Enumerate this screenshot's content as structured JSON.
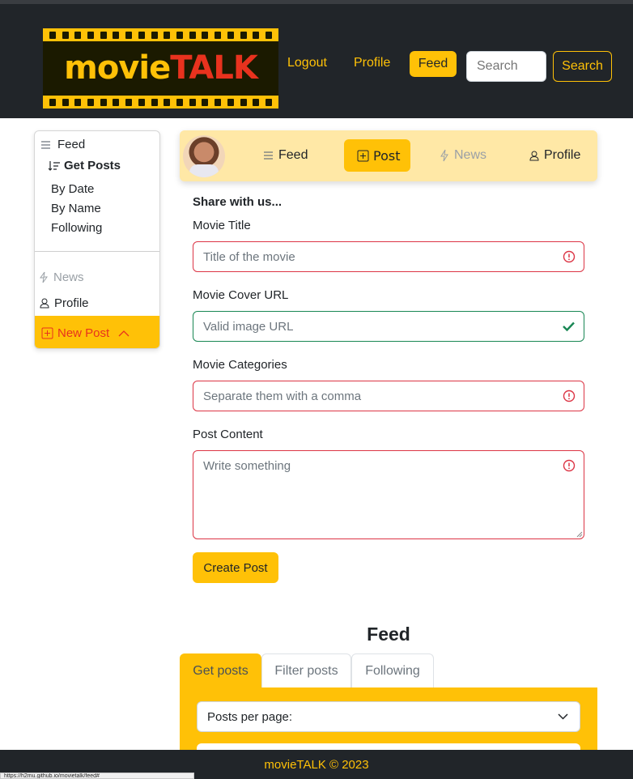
{
  "navbar": {
    "logo": {
      "part1": "movie",
      "part2": "TALK"
    },
    "links": {
      "logout": "Logout",
      "profile": "Profile",
      "feed": "Feed"
    },
    "search": {
      "placeholder": "Search",
      "button": "Search"
    }
  },
  "sidebar": {
    "feed": "Feed",
    "get_posts": "Get Posts",
    "by_date": "By Date",
    "by_name": "By Name",
    "following": "Following",
    "news": "News",
    "profile": "Profile",
    "new_post": "New Post"
  },
  "postnav": {
    "feed": "Feed",
    "post": "Post",
    "news": "News",
    "profile": "Profile"
  },
  "form": {
    "heading": "Share with us...",
    "title_label": "Movie Title",
    "title_placeholder": "Title of the movie",
    "cover_label": "Movie Cover URL",
    "cover_placeholder": "Valid image URL",
    "categories_label": "Movie Categories",
    "categories_placeholder": "Separate them with a comma",
    "content_label": "Post Content",
    "content_placeholder": "Write something",
    "submit": "Create Post"
  },
  "feed": {
    "title": "Feed",
    "tabs": [
      "Get posts",
      "Filter posts",
      "Following"
    ],
    "posts_per_page": "Posts per page:"
  },
  "footer": {
    "text": "movieTALK © 2023"
  },
  "status_bar": {
    "url": "https://h2mu.github.io/movietalk/feed#"
  },
  "colors": {
    "accent": "#ffc107",
    "dark": "#212529",
    "danger": "#dc3545",
    "success": "#198754",
    "brand_red": "#e8321e"
  }
}
